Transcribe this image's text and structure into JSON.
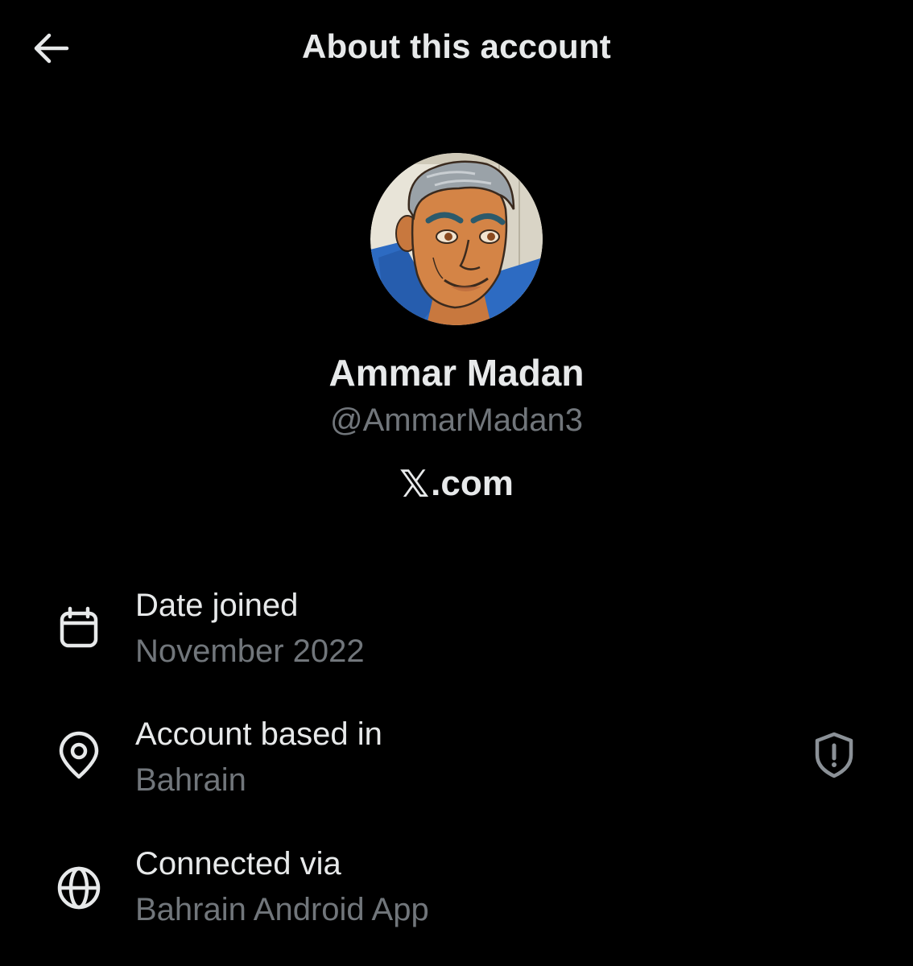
{
  "header": {
    "title": "About this account",
    "back_icon": "arrow-left-icon"
  },
  "profile": {
    "display_name": "Ammar Madan",
    "handle": "@AmmarMadan3",
    "platform_logo": "𝕏",
    "platform_domain": ".com"
  },
  "details": [
    {
      "icon": "calendar-icon",
      "label": "Date joined",
      "value": "November 2022"
    },
    {
      "icon": "location-pin-icon",
      "label": "Account based in",
      "value": "Bahrain",
      "action_icon": "shield-alert-icon"
    },
    {
      "icon": "globe-icon",
      "label": "Connected via",
      "value": "Bahrain Android App"
    }
  ],
  "colors": {
    "background": "#000000",
    "primary_text": "#e7e9ea",
    "secondary_text": "#71767b"
  }
}
